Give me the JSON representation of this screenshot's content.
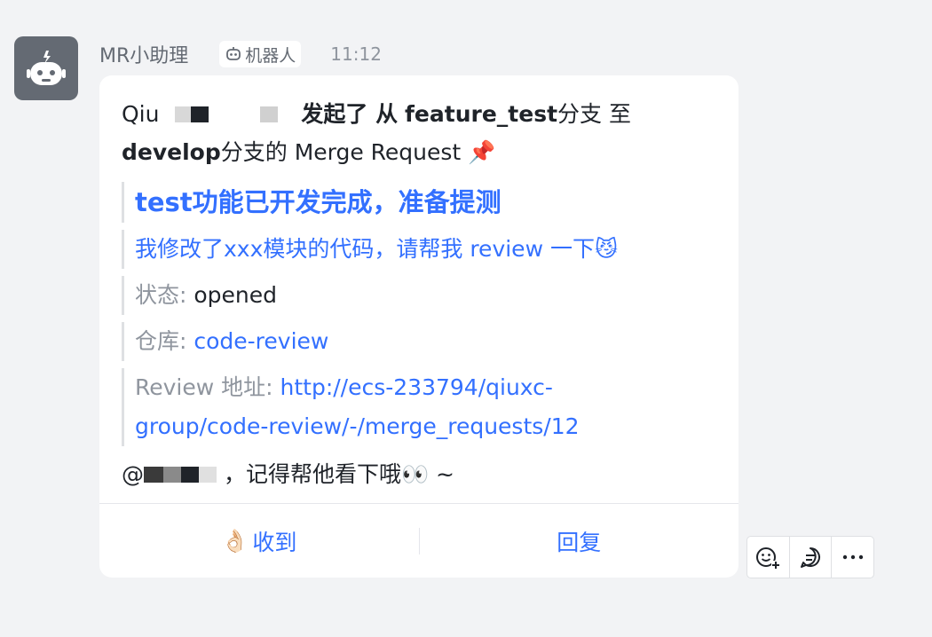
{
  "header": {
    "sender": "MR小助理",
    "badge": "机器人",
    "time": "11:12"
  },
  "message": {
    "author_visible": "Qiu",
    "text_initiated": "发起了 从",
    "source_branch": "feature_test",
    "text_branch_to": "分支 至",
    "target_branch": "develop",
    "text_branch_mr": "分支的 Merge Request",
    "pin_emoji": "📌",
    "mr_title": "test功能已开发完成，准备提测",
    "mr_description": "我修改了xxx模块的代码，请帮我 review 一下",
    "desc_emoji": "😼",
    "status_label": "状态: ",
    "status_value": "opened",
    "repo_label": "仓库: ",
    "repo_value": "code-review",
    "review_label": "Review 地址: ",
    "review_url_line1": "http://ecs-233794/qiuxc-",
    "review_url_line2": "group/code-review/-/merge_requests/12",
    "mention_prefix": "@",
    "mention_text": "，记得帮他看下哦",
    "mention_emoji": "👀",
    "mention_suffix": " ~"
  },
  "actions": {
    "ack_emoji": "👌🏻",
    "ack_label": "收到",
    "reply_label": "回复"
  },
  "toolbar": {
    "icons": [
      "add-reaction-icon",
      "thread-reply-icon",
      "more-icon"
    ]
  },
  "colors": {
    "background": "#f2f3f5",
    "link": "#3370ff",
    "muted": "#8f959e",
    "avatar": "#646a73"
  }
}
